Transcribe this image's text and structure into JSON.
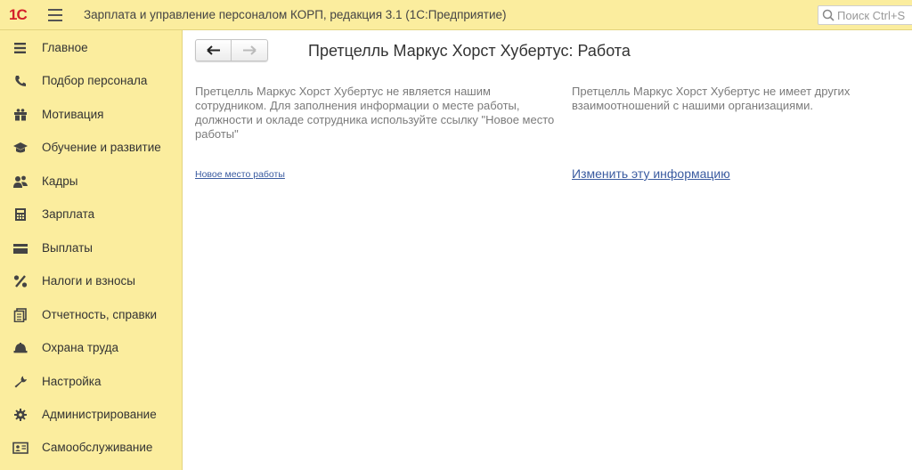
{
  "header": {
    "logo_text": "1С",
    "app_title": "Зарплата и управление персоналом КОРП, редакция 3.1   (1С:Предприятие)",
    "search_placeholder": "Поиск Ctrl+S"
  },
  "sidebar": {
    "items": [
      {
        "label": "Главное",
        "icon": "list-icon"
      },
      {
        "label": "Подбор персонала",
        "icon": "phone-icon"
      },
      {
        "label": "Мотивация",
        "icon": "gift-icon"
      },
      {
        "label": "Обучение и развитие",
        "icon": "graduation-cap-icon"
      },
      {
        "label": "Кадры",
        "icon": "people-icon"
      },
      {
        "label": "Зарплата",
        "icon": "calculator-icon"
      },
      {
        "label": "Выплаты",
        "icon": "wallet-icon"
      },
      {
        "label": "Налоги и взносы",
        "icon": "percent-icon"
      },
      {
        "label": "Отчетность, справки",
        "icon": "documents-icon"
      },
      {
        "label": "Охрана труда",
        "icon": "helmet-icon"
      },
      {
        "label": "Настройка",
        "icon": "wrench-icon"
      },
      {
        "label": "Администрирование",
        "icon": "gear-icon"
      },
      {
        "label": "Самообслуживание",
        "icon": "id-card-icon"
      }
    ]
  },
  "main": {
    "title": "Претцелль Маркус Хорст Хубертус: Работа",
    "left_info": "Претцелль Маркус Хорст Хубертус не является нашим сотрудником. Для заполнения информации о месте работы, должности и окладе сотрудника используйте ссылку \"Новое место работы\"",
    "right_info": "Претцелль Маркус Хорст Хубертус не имеет других взаимоотношений с нашими организациями.",
    "new_job_link": "Новое место работы",
    "change_info_link": "Изменить эту информацию"
  },
  "colors": {
    "panel_bg": "#fbed9e",
    "link": "#3a5ba0",
    "logo_red": "#d4202a"
  }
}
